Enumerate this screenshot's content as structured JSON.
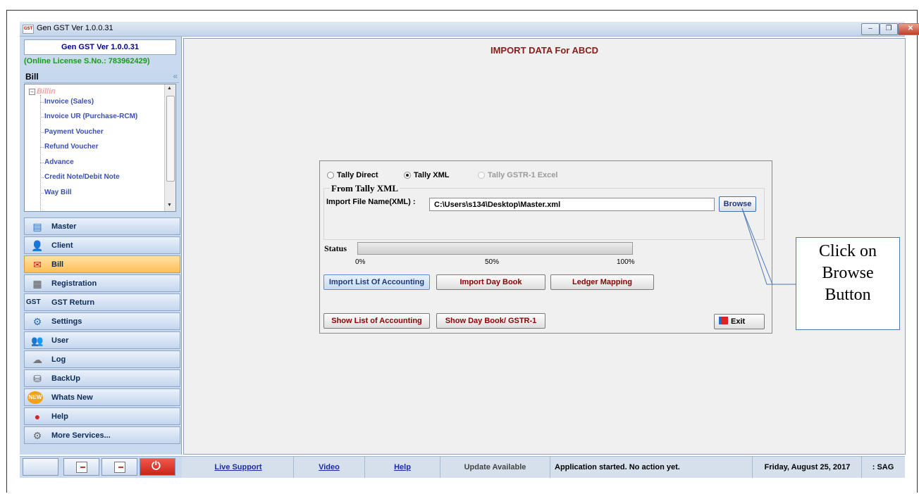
{
  "window": {
    "app_icon": "GST",
    "title": "Gen GST  Ver 1.0.0.31",
    "controls": [
      "minimize-icon",
      "restore-icon",
      "close-icon"
    ]
  },
  "sidebar": {
    "title": "Gen GST  Ver 1.0.0.31",
    "license": "(Online License S.No.: 783962429)",
    "section_label": "Bill",
    "collapse_glyph": "«",
    "tree": {
      "root": "Billin",
      "items": [
        "Invoice (Sales)",
        "Invoice UR (Purchase-RCM)",
        "Payment Voucher",
        "Refund Voucher",
        "Advance",
        "Credit Note/Debit Note",
        "Way Bill"
      ]
    },
    "nav": [
      {
        "label": "Master",
        "icon": "master-icon",
        "glyph": "▤"
      },
      {
        "label": "Client",
        "icon": "client-icon",
        "glyph": "👤"
      },
      {
        "label": "Bill",
        "icon": "bill-icon",
        "glyph": "✉",
        "active": true
      },
      {
        "label": "Registration",
        "icon": "registration-icon",
        "glyph": "▦"
      },
      {
        "label": "GST Return",
        "icon": "gst-icon",
        "glyph": "GST"
      },
      {
        "label": "Settings",
        "icon": "settings-icon",
        "glyph": "⚙"
      },
      {
        "label": "User",
        "icon": "user-icon",
        "glyph": "👥"
      },
      {
        "label": "Log",
        "icon": "log-icon",
        "glyph": "☁"
      },
      {
        "label": "BackUp",
        "icon": "backup-icon",
        "glyph": "⛁"
      },
      {
        "label": "Whats New",
        "icon": "new-badge-icon",
        "glyph": "NEW"
      },
      {
        "label": "Help",
        "icon": "help-icon",
        "glyph": "●"
      },
      {
        "label": "More Services...",
        "icon": "services-icon",
        "glyph": "⚙"
      }
    ]
  },
  "main": {
    "title": "IMPORT DATA For ABCD",
    "dialog": {
      "radios": [
        {
          "label": "Tally Direct",
          "selected": false,
          "enabled": true
        },
        {
          "label": "Tally XML",
          "selected": true,
          "enabled": true
        },
        {
          "label": "Tally GSTR-1 Excel",
          "selected": false,
          "enabled": false
        }
      ],
      "group_title": "From Tally XML",
      "file_label": "Import File Name(XML)  :",
      "file_value": "C:\\Users\\s134\\Desktop\\Master.xml",
      "browse_label": "Browse",
      "status_label": "Status",
      "progress_value": 0,
      "progress_ticks": [
        "0%",
        "50%",
        "100%"
      ],
      "buttons": {
        "import_list": "Import List Of Accounting",
        "import_day": "Import Day Book",
        "ledger": "Ledger Mapping",
        "show_list": "Show List of Accounting",
        "show_day": "Show Day Book/ GSTR-1",
        "exit": "Exit"
      }
    }
  },
  "callout": {
    "lines": [
      "Click on",
      "Browse",
      "Button"
    ]
  },
  "statusbar": {
    "live_support": "Live Support",
    "video": "Video",
    "help": "Help",
    "update": "Update Available",
    "message": "Application started. No action yet.",
    "date": "Friday, August 25, 2017",
    "user": ": SAG"
  },
  "colors": {
    "title_red": "#8b1a1a",
    "license_green": "#1a9a1a",
    "link_blue": "#1c2aa8",
    "active_nav": "#ffbf57"
  }
}
